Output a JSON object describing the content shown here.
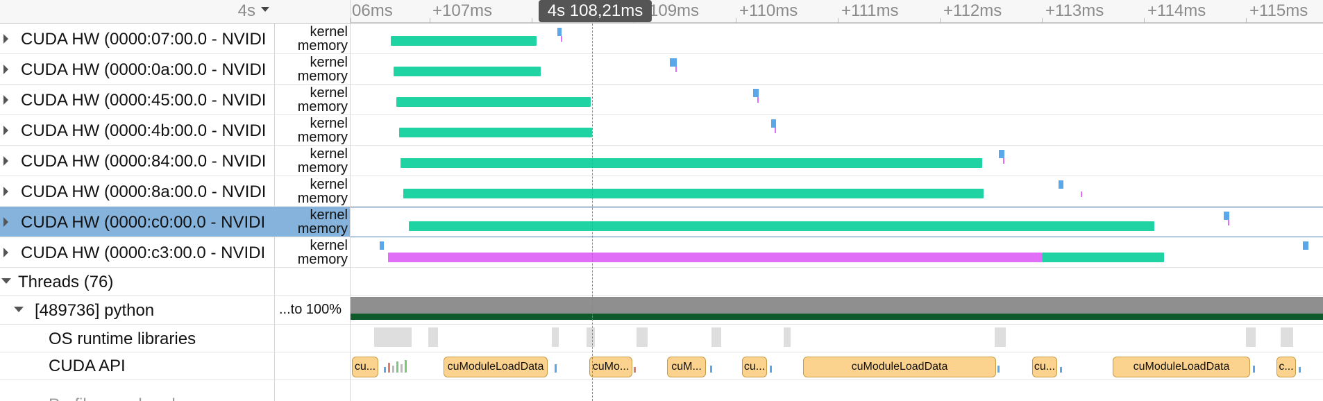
{
  "header": {
    "time_base": "4s",
    "cursor_time": "4s 108,21ms",
    "ticks": [
      "06ms",
      "+107ms",
      "109ms",
      "+110ms",
      "+111ms",
      "+112ms",
      "+113ms",
      "+114ms",
      "+115ms"
    ]
  },
  "tree": {
    "rows": [
      {
        "label": "CUDA HW (0000:07:00.0 - NVIDI"
      },
      {
        "label": "CUDA HW (0000:0a:00.0 - NVIDI"
      },
      {
        "label": "CUDA HW (0000:45:00.0 - NVIDI"
      },
      {
        "label": "CUDA HW (0000:4b:00.0 - NVIDI"
      },
      {
        "label": "CUDA HW (0000:84:00.0 - NVIDI"
      },
      {
        "label": "CUDA HW (0000:8a:00.0 - NVIDI"
      },
      {
        "label": "CUDA HW (0000:c0:00.0 - NVIDI"
      },
      {
        "label": "CUDA HW (0000:c3:00.0 - NVIDI"
      },
      {
        "label": "Threads (76)"
      },
      {
        "label": "[489736] python"
      },
      {
        "label": "OS runtime libraries"
      },
      {
        "label": "CUDA API"
      },
      {
        "label": "Profiler overhead"
      }
    ]
  },
  "labels": {
    "kernel": "kernel",
    "memory": "memory",
    "util": "...to 100%"
  },
  "api_calls": [
    {
      "label": "cu..."
    },
    {
      "label": "cuModuleLoadData"
    },
    {
      "label": "cuMo..."
    },
    {
      "label": "cuM..."
    },
    {
      "label": "cu..."
    },
    {
      "label": "cuModuleLoadData"
    },
    {
      "label": "cu..."
    },
    {
      "label": "cuModuleLoadData"
    },
    {
      "label": "c..."
    }
  ],
  "colors": {
    "kernel_bar": "#1fd3a3",
    "memcpy_bar": "#e06ef7",
    "selection": "#86b3dc",
    "api_box": "#fbd38e",
    "cpu_util": "#8f8f8f",
    "cpu_util_dark": "#0d5a2c"
  }
}
